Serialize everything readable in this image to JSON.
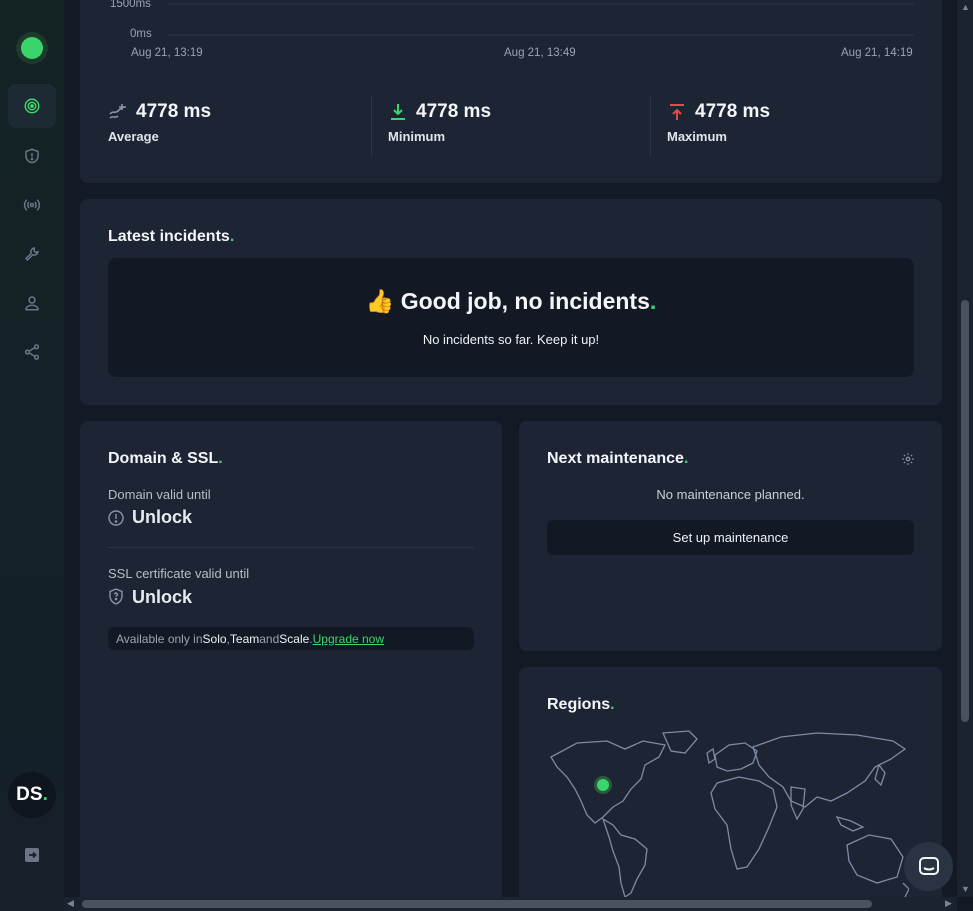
{
  "sidebar": {
    "items": [
      {
        "name": "monitors",
        "icon": "target-icon",
        "active": true
      },
      {
        "name": "incidents",
        "icon": "shield-alert-icon",
        "active": false
      },
      {
        "name": "heartbeats",
        "icon": "broadcast-icon",
        "active": false
      },
      {
        "name": "maintenance",
        "icon": "wrench-icon",
        "active": false
      },
      {
        "name": "team",
        "icon": "user-icon",
        "active": false
      },
      {
        "name": "integrations",
        "icon": "share-nodes-icon",
        "active": false
      }
    ],
    "avatar_initials": "DS",
    "avatar_dot": "."
  },
  "chart_data": {
    "type": "line",
    "y_ticks": [
      "1500ms",
      "0ms"
    ],
    "x_ticks": [
      "Aug 21, 13:19",
      "Aug 21, 13:49",
      "Aug 21, 14:19"
    ],
    "series": []
  },
  "response_stats": [
    {
      "value": "4778 ms",
      "label": "Average",
      "icon": "trend-icon"
    },
    {
      "value": "4778 ms",
      "label": "Minimum",
      "icon": "arrow-down-icon"
    },
    {
      "value": "4778 ms",
      "label": "Maximum",
      "icon": "arrow-up-icon"
    }
  ],
  "incidents": {
    "title": "Latest incidents",
    "dot": ".",
    "emoji": "👍",
    "headline": "Good job, no incidents",
    "subtitle": "No incidents so far. Keep it up!"
  },
  "domain_ssl": {
    "title": "Domain & SSL",
    "dot": ".",
    "domain_label": "Domain valid until",
    "domain_value": "Unlock",
    "ssl_label": "SSL certificate valid until",
    "ssl_value": "Unlock",
    "note_prefix": "Available only in ",
    "plan1": "Solo",
    "sep1": ", ",
    "plan2": "Team",
    "and": " and ",
    "plan3": "Scale",
    "period": ". ",
    "upgrade_link": "Upgrade now"
  },
  "maintenance": {
    "title": "Next maintenance",
    "dot": ".",
    "empty_text": "No maintenance planned.",
    "button": "Set up maintenance"
  },
  "regions": {
    "title": "Regions",
    "dot": ".",
    "active_region": "North America"
  },
  "colors": {
    "accent": "#3bd56b",
    "card": "#1d2535",
    "background": "#131a25",
    "danger": "#e5484d"
  }
}
